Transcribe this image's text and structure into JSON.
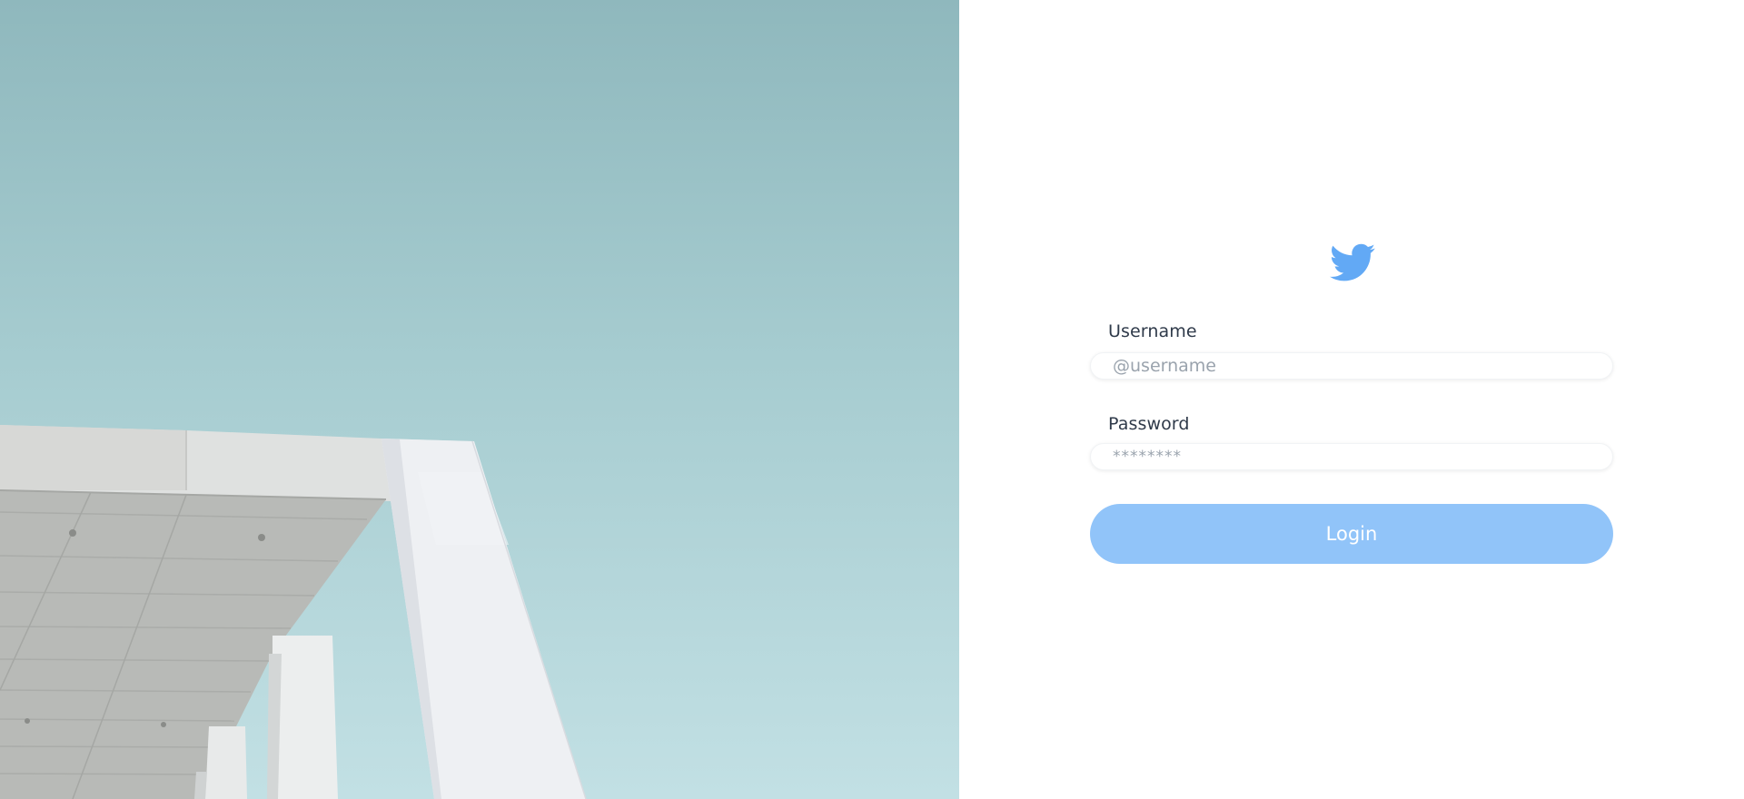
{
  "brand": {
    "logo_icon": "twitter-bird-icon",
    "accent": "#62a9f5"
  },
  "form": {
    "username_label": "Username",
    "username_placeholder": "@username",
    "password_label": "Password",
    "password_placeholder": "********",
    "login_label": "Login"
  },
  "colors": {
    "button": "#91c4f9",
    "sky_top": "#8fb8bd",
    "sky_bottom": "#c2e0e4"
  }
}
